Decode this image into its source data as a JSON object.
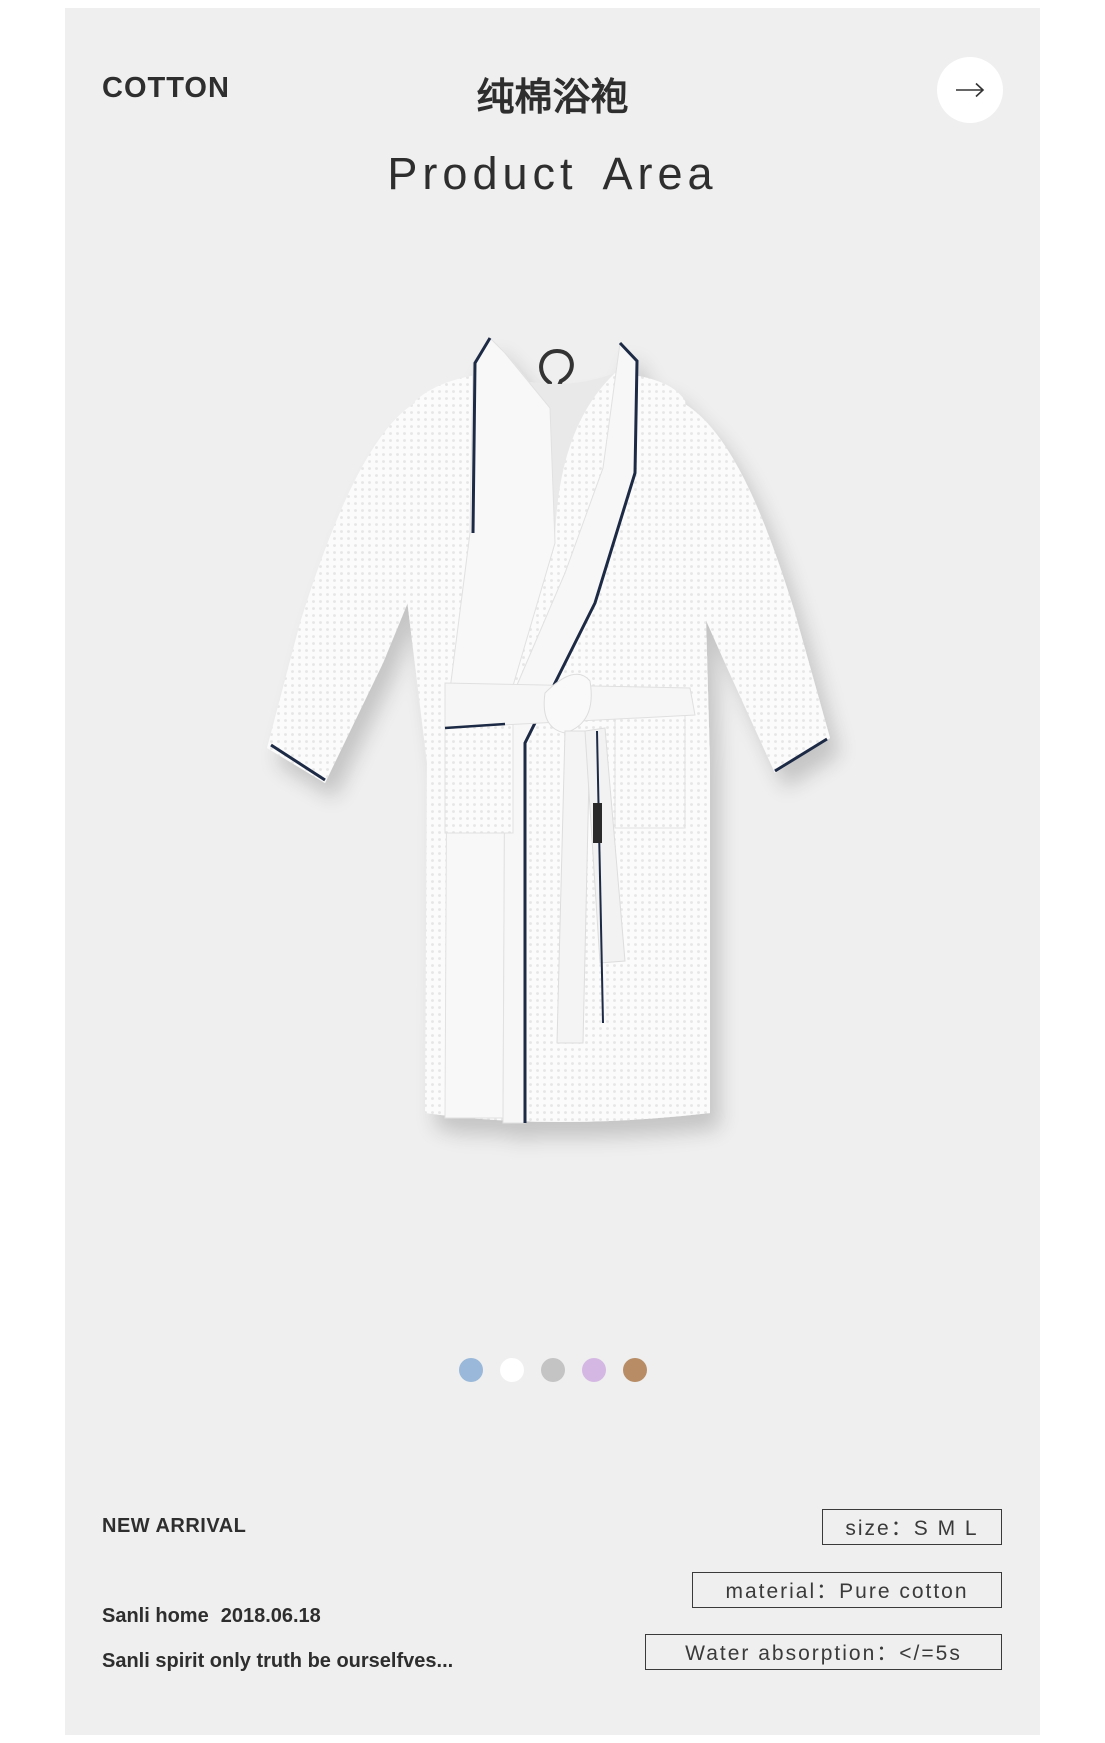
{
  "header": {
    "brand": "COTTON",
    "title_cn": "纯棉浴袍",
    "title_en": "Product Area",
    "arrow_icon": "arrow-right-icon"
  },
  "product": {
    "image": "white-bathrobe-on-hanger"
  },
  "color_options": [
    {
      "name": "blue",
      "color": "#9ab8d9"
    },
    {
      "name": "white",
      "color": "#ffffff"
    },
    {
      "name": "gray",
      "color": "#c4c4c4"
    },
    {
      "name": "lavender",
      "color": "#d4b8e3"
    },
    {
      "name": "brown",
      "color": "#b88d66"
    }
  ],
  "footer": {
    "new_arrival": "NEW ARRIVAL",
    "store_name": "Sanli home",
    "date": "2018.06.18",
    "slogan": "Sanli spirit only truth be ourselfves..."
  },
  "specs": {
    "size": "size：S M L",
    "material": "material：Pure cotton",
    "water": "Water absorption：</=5s"
  }
}
